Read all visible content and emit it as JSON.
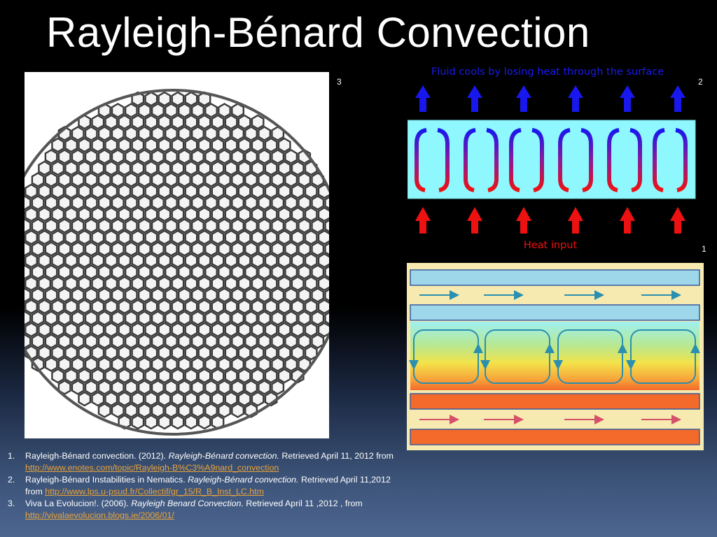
{
  "slide": {
    "title": "Rayleigh-Bénard Convection"
  },
  "figures": {
    "cells_label": "3",
    "convection_label": "2",
    "nematic_label": "1",
    "convection": {
      "top_caption": "Fluid cools by losing heat through the surface",
      "bottom_caption": "Heat input",
      "colors": {
        "cold": "#1a1aee",
        "hot": "#ee1111",
        "fluid": "#8ff8ff"
      }
    }
  },
  "references": [
    {
      "num": "1.",
      "pre": "Rayleigh-Bénard convection. (2012). ",
      "title": "Rayleigh-Bénard convection.",
      "post": " Retrieved April 11, 2012 from ",
      "url": "http://www.enotes.com/topic/Rayleigh-B%C3%A9nard_convection"
    },
    {
      "num": "2.",
      "pre": "Rayleigh-Bénard Instabilities in Nematics. ",
      "title": "Rayleigh-Bénard convection.",
      "post": " Retrieved April 11,2012 from ",
      "url": "http://www.lps.u-psud.fr/Collectif/gr_15/R_B_Inst_LC.htm"
    },
    {
      "num": "3.",
      "pre": "Viva La Evolucion!. (2006). ",
      "title": "Rayleigh Benard Convection.",
      "post": " Retrieved  April 11 ,2012 , from ",
      "url": "http://vivalaevolucion.blogs.ie/2006/01/"
    }
  ]
}
